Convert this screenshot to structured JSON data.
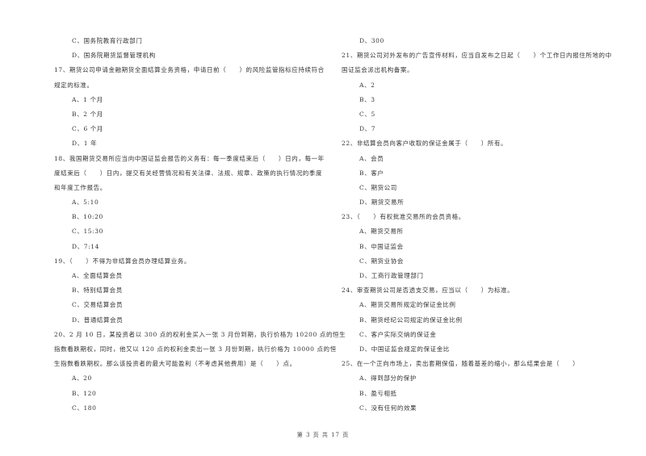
{
  "left_column": [
    {
      "type": "option",
      "text": "C、国务院教育行政部门"
    },
    {
      "type": "option",
      "text": "D、国务院期货监督管理机构"
    },
    {
      "type": "question",
      "text": "17、期货公司申请金融期货全面结算业务资格，申请日前（　　）的风险监管指标应持续符合"
    },
    {
      "type": "question",
      "text": "规定的标准。"
    },
    {
      "type": "option",
      "text": "A、1 个月"
    },
    {
      "type": "option",
      "text": "B、2 个月"
    },
    {
      "type": "option",
      "text": "C、6 个月"
    },
    {
      "type": "option",
      "text": "D、1 年"
    },
    {
      "type": "question",
      "text": "18、我国期货交易所应当向中国证监会报告的义务有：每一季度结束后（　　）日内，每一年"
    },
    {
      "type": "question",
      "text": "度结束后（　　）日内，提交有关经营情况和有关法律、法规、规章、政策的执行情况的季度"
    },
    {
      "type": "question",
      "text": "和年度工作报告。"
    },
    {
      "type": "option",
      "text": "A、5:10"
    },
    {
      "type": "option",
      "text": "B、10:20"
    },
    {
      "type": "option",
      "text": "C、15:30"
    },
    {
      "type": "option",
      "text": "D、7:14"
    },
    {
      "type": "question",
      "text": "19、（　　）不得为非结算会员办理结算业务。"
    },
    {
      "type": "option",
      "text": "A、全面结算会员"
    },
    {
      "type": "option",
      "text": "B、特别结算会员"
    },
    {
      "type": "option",
      "text": "C、交易结算会员"
    },
    {
      "type": "option",
      "text": "D、普通结算会员"
    },
    {
      "type": "question",
      "text": "20、2 月 10 日，某投资者以 300 点的权利金买入一张 3 月份到期，执行价格为 10200 点的恒生"
    },
    {
      "type": "question",
      "text": "指数看跌期权，同时，他又以 120 点的权利金卖出一张 3 月份到期，执行价格为 10000 点的恒"
    },
    {
      "type": "question",
      "text": "生指数看跌期权。那么该投资者的最大可能盈利（不考虑其他费用）是（　　）点。"
    },
    {
      "type": "option",
      "text": "A、20"
    },
    {
      "type": "option",
      "text": "B、120"
    },
    {
      "type": "option",
      "text": "C、180"
    }
  ],
  "right_column": [
    {
      "type": "option",
      "text": "D、300"
    },
    {
      "type": "question",
      "text": "21、期货公司对外发布的广告宣传材料，应当自发布之日起（　　）个工作日内报住所地的中"
    },
    {
      "type": "question",
      "text": "国证监会派出机构备案。"
    },
    {
      "type": "option",
      "text": "A、2"
    },
    {
      "type": "option",
      "text": "B、3"
    },
    {
      "type": "option",
      "text": "C、5"
    },
    {
      "type": "option",
      "text": "D、7"
    },
    {
      "type": "question",
      "text": "22、非结算会员向客户收取的保证金属于（　　）所有。"
    },
    {
      "type": "option",
      "text": "A、会员"
    },
    {
      "type": "option",
      "text": "B、客户"
    },
    {
      "type": "option",
      "text": "C、期货公司"
    },
    {
      "type": "option",
      "text": "D、期货交易所"
    },
    {
      "type": "question",
      "text": "23、（　　）有权批准交易所的会员资格。"
    },
    {
      "type": "option",
      "text": "A、期货交易所"
    },
    {
      "type": "option",
      "text": "B、中国证监会"
    },
    {
      "type": "option",
      "text": "C、期货业协会"
    },
    {
      "type": "option",
      "text": "D、工商行政管理部门"
    },
    {
      "type": "question",
      "text": "24、审查期货公司是否透支交易，应当以（　　）为标准。"
    },
    {
      "type": "option",
      "text": "A、期货交易所规定的保证金比例"
    },
    {
      "type": "option",
      "text": "B、期货经纪公司规定的保证金比例"
    },
    {
      "type": "option",
      "text": "C、客户实际交纳的保证金"
    },
    {
      "type": "option",
      "text": "D、中国证监会规定的保证金比"
    },
    {
      "type": "question",
      "text": "25、在一个正向市场上，卖出套期保值，随着基差的缩小，那么结果会是（　　）"
    },
    {
      "type": "option",
      "text": "A、得到部分的保护"
    },
    {
      "type": "option",
      "text": "B、盈亏相抵"
    },
    {
      "type": "option",
      "text": "C、没有任何的效果"
    }
  ],
  "footer": {
    "page_label": "第 3 页 共 17 页"
  }
}
